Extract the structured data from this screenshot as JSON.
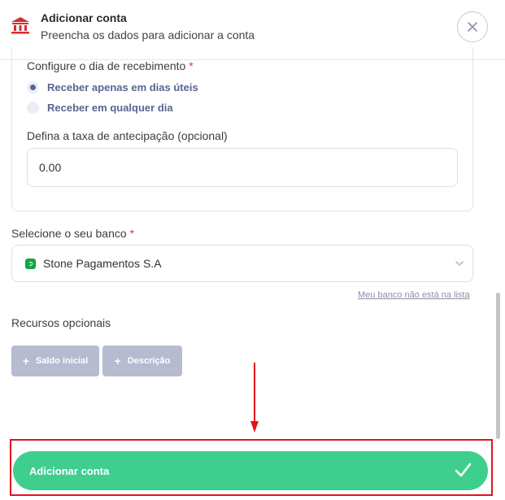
{
  "header": {
    "title": "Adicionar conta",
    "subtitle": "Preencha os dados para adicionar a conta",
    "icon": "bank-icon",
    "close_icon": "close-icon"
  },
  "receipt": {
    "label": "Configure o dia de recebimento",
    "required_mark": "*",
    "options": [
      {
        "label": "Receber apenas em dias úteis",
        "checked": true
      },
      {
        "label": "Receber em qualquer dia",
        "checked": false
      }
    ]
  },
  "anticipation": {
    "label": "Defina a taxa de antecipação (opcional)",
    "value": "0.00"
  },
  "bank": {
    "label": "Selecione o seu banco",
    "required_mark": "*",
    "selected": "Stone Pagamentos S.A",
    "not_listed_link": "Meu banco não está na lista"
  },
  "optional_resources": {
    "label": "Recursos opcionais",
    "buttons": [
      {
        "label": "Saldo inicial"
      },
      {
        "label": "Descrição"
      }
    ]
  },
  "submit": {
    "label": "Adicionar conta"
  },
  "colors": {
    "accent_green": "#3ecf8e",
    "highlight_red": "#e0141e",
    "bank_icon_red": "#d32f2f",
    "radio_text": "#5b6490"
  }
}
